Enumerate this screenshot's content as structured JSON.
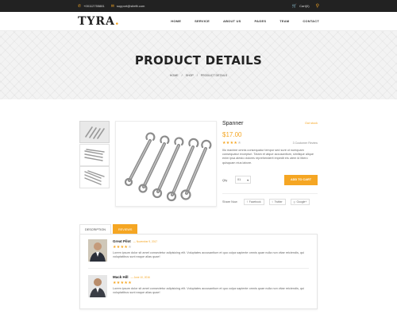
{
  "topbar": {
    "phone": "+00112755881",
    "email": "support@sitefit.com",
    "cart": "Cart(0)",
    "icons": {
      "phone": "phone-icon",
      "email": "mail-icon",
      "cart": "cart-icon",
      "search": "search-icon"
    }
  },
  "brand": {
    "name": "TYRA",
    "dot": ".",
    "accent": "#f5a623"
  },
  "nav": [
    "HOME",
    "SERVICE",
    "ABOUT US",
    "PAGES",
    "TEAM",
    "CONTACT"
  ],
  "hero": {
    "title": "PRODUCT DETAILS",
    "breadcrumb": [
      "HOME",
      "/",
      "SHOP",
      "/",
      "PRODUCT DETAILS"
    ]
  },
  "product": {
    "name": "Spanner",
    "stock": "Out stock",
    "price": "$17.00",
    "rating": 4,
    "max_rating": 5,
    "reviews": "3 Customer Review",
    "description": "Illo maxime omnis consequatur tempor sed sunt ut numquam consequatur excepturi. Totam et atque accusantium, similique alique enim ipsa alesto dolores reprehenderit impedit eis utem id libero quisquam eius labore.",
    "qty_label": "Qty",
    "qty_value": "01",
    "add_to_cart": "ADD TO CART",
    "share_label": "Share Now",
    "share": [
      {
        "icon": "facebook-icon",
        "glyph": "f",
        "label": "Facebook"
      },
      {
        "icon": "twitter-icon",
        "glyph": "t",
        "label": "Twitter"
      },
      {
        "icon": "google-icon",
        "glyph": "g",
        "label": "Google+"
      }
    ]
  },
  "tabs": [
    "DESCRIPTION",
    "REVIEWS"
  ],
  "reviews": [
    {
      "name": "Great Pilot",
      "date": "— November 9, 2017",
      "rating": 4,
      "text": "Lorem ipsum dolor sit amet consectetur adipisicing elit. Voluptates accusantium et quo culpa sapiente omnis quae nulla non vitae reiciendis, qui voluptatibus sunt eaque alias quae!"
    },
    {
      "name": "Mack Hill",
      "date": "— June 10, 2016",
      "rating": 5,
      "text": "Lorem ipsum dolor sit amet consectetur adipisicing elit. Voluptates accusantium et quo culpa sapiente omnis quae nulla non vitae reiciendis, qui voluptatibus sunt eaque alias quae!"
    }
  ]
}
